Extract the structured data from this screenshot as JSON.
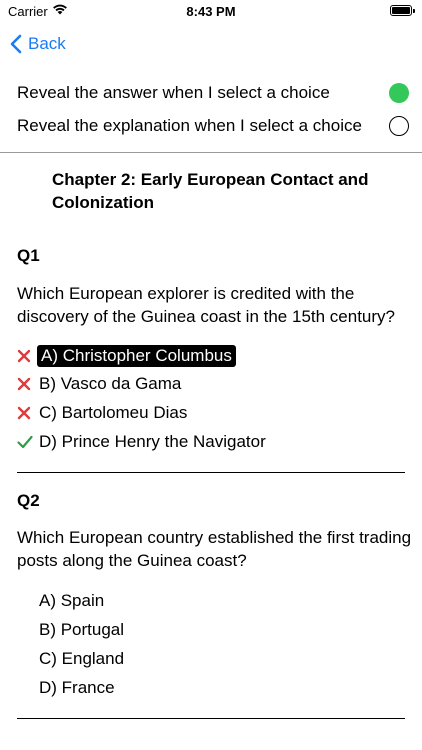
{
  "status_bar": {
    "carrier": "Carrier",
    "time": "8:43 PM"
  },
  "nav": {
    "back_label": "Back",
    "accent_color": "#1a7cf5"
  },
  "settings": [
    {
      "label": "Reveal the answer when I select a choice",
      "enabled": true
    },
    {
      "label": "Reveal the explanation when I select a choice",
      "enabled": false
    }
  ],
  "chapter_title": "Chapter 2: Early European Contact and Colonization",
  "questions": [
    {
      "label": "Q1",
      "text": "Which European explorer is credited with the discovery of the Guinea coast in the 15th century?",
      "options": [
        {
          "text": "A) Christopher Columbus",
          "mark": "cross-icon",
          "selected": true
        },
        {
          "text": "B) Vasco da Gama",
          "mark": "cross-icon",
          "selected": false
        },
        {
          "text": "C) Bartolomeu Dias",
          "mark": "cross-icon",
          "selected": false
        },
        {
          "text": "D) Prince Henry the Navigator",
          "mark": "check-icon",
          "selected": false
        }
      ]
    },
    {
      "label": "Q2",
      "text": "Which European country established the first trading posts along the Guinea coast?",
      "options": [
        {
          "text": "A) Spain"
        },
        {
          "text": "B) Portugal"
        },
        {
          "text": "C) England"
        },
        {
          "text": "D) France"
        }
      ]
    }
  ],
  "colors": {
    "toggle_on": "#34c759",
    "wrong_mark": "#e03a3a",
    "correct_mark": "#2e9e44"
  }
}
